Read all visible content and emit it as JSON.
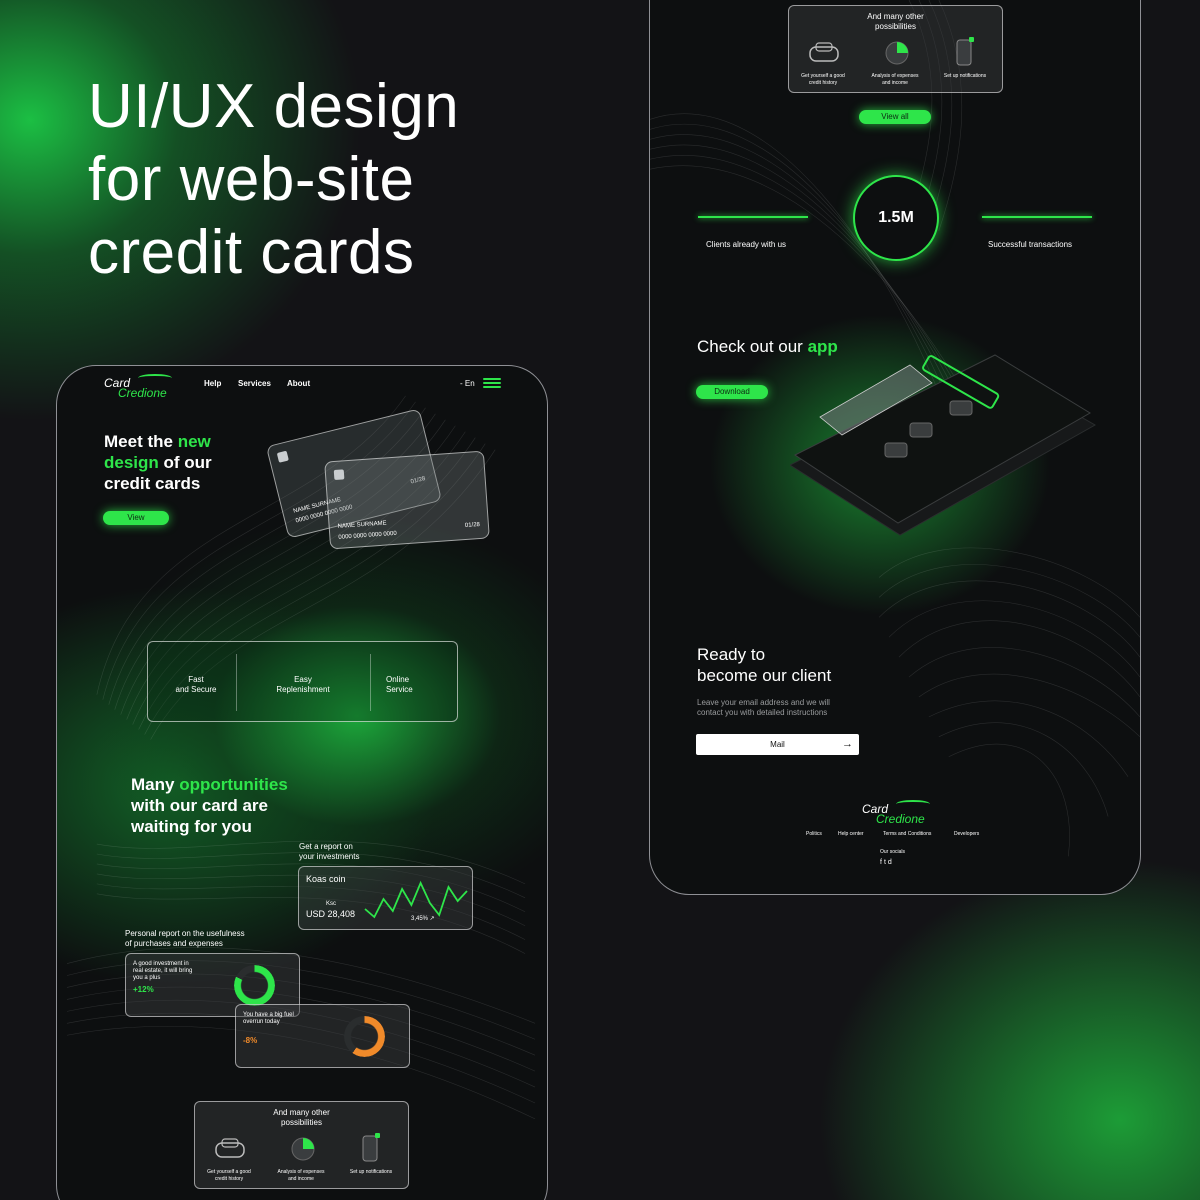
{
  "hero": {
    "line1": "UI/UX design",
    "line2": "for web-site",
    "line3": "credit cards"
  },
  "colors": {
    "accent": "#2ee54a",
    "background": "#131316",
    "warning": "#f08a2a"
  },
  "logo": {
    "line1": "Card",
    "line2": "Credione"
  },
  "nav": {
    "help": "Help",
    "services": "Services",
    "about": "About",
    "language": "En",
    "menu_icon": "hamburger-icon"
  },
  "intro": {
    "l1a": "Meet the ",
    "l1b": "new",
    "l2a": "design",
    "l2b": " of our",
    "l3": "credit cards",
    "view_button": "View"
  },
  "card_back": {
    "name": "NAME SURNAME",
    "number": "0000 0000 0000 0000",
    "expiry": "01/28"
  },
  "card_front": {
    "name": "NAME SURNAME",
    "number": "0000 0000 0000 0000",
    "expiry": "01/28"
  },
  "features": [
    {
      "l1": "Fast",
      "l2": "and Secure"
    },
    {
      "l1": "Easy",
      "l2": "Replenishment"
    },
    {
      "l1": "Online",
      "l2": "Service"
    }
  ],
  "opportunities": {
    "l1a": "Many ",
    "l1b": "opportunities",
    "l2": "with our card are",
    "l3": "waiting for you"
  },
  "investment": {
    "caption_l1": "Get a report on",
    "caption_l2": "your investments",
    "coin": "Koas coin",
    "ticker": "Ksc",
    "value": "USD 28,408",
    "change": "3,45% ↗",
    "sparkline": [
      38,
      46,
      28,
      40,
      18,
      34,
      12,
      32,
      44,
      16,
      30,
      20
    ]
  },
  "report": {
    "caption_l1": "Personal report on the usefulness",
    "caption_l2": "of purchases and expenses",
    "good": {
      "l1": "A good investment in",
      "l2": "real estate, it will bring",
      "l3": "you a plus",
      "value": "+12%",
      "fraction": 0.82
    },
    "bad": {
      "l1": "You have a big fuel",
      "l2": "overrun today",
      "value": "-8%",
      "fraction": 0.6
    }
  },
  "possibilities": {
    "title_l1": "And many other",
    "title_l2": "possibilities",
    "items": [
      {
        "l1": "Get yourself a good",
        "l2": "credit history",
        "icon": "car-icon"
      },
      {
        "l1": "Analysis of expenses",
        "l2": "and income",
        "icon": "pie-chart-icon"
      },
      {
        "l1": "Set up notifications",
        "l2": "",
        "icon": "phone-notification-icon"
      }
    ],
    "view_all": "View all"
  },
  "stats": {
    "value": "1.5M",
    "left_label": "Clients already with us",
    "right_label": "Successful transactions"
  },
  "app": {
    "title_a": "Check out our ",
    "title_b": "app",
    "download": "Download"
  },
  "cta": {
    "l1": "Ready to",
    "l2": "become our client",
    "desc_l1": "Leave your email address and we will",
    "desc_l2": "contact you with detailed instructions",
    "mail_placeholder": "Mail"
  },
  "footer": {
    "links": [
      "Politics",
      "Help center",
      "Terms and Conditions",
      "Developers"
    ],
    "socials_label": "Our socials",
    "social_icons": [
      "facebook-icon",
      "twitter-icon",
      "discord-icon"
    ]
  }
}
